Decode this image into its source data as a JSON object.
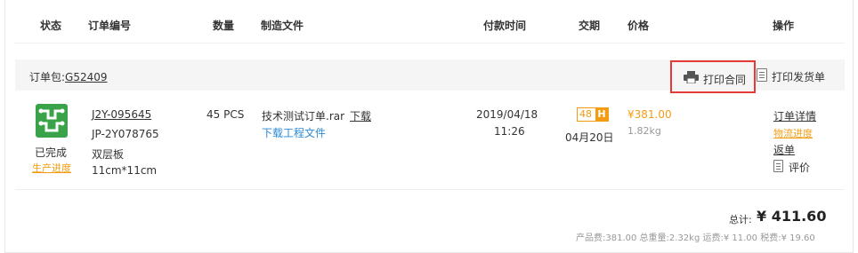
{
  "headers": {
    "status": "状态",
    "order_no": "订单编号",
    "quantity": "数量",
    "files": "制造文件",
    "pay_time": "付款时间",
    "delivery": "交期",
    "price": "价格",
    "actions": "操作"
  },
  "package": {
    "label": "订单包:",
    "code": "G52409",
    "print_contract": "打印合同",
    "print_shipping": "打印发货单"
  },
  "order": {
    "status_text": "已完成",
    "progress_link": "生产进度",
    "order_no": "J2Y-095645",
    "prod_no": "JP-2Y078765",
    "board_type": "双层板",
    "size": "11cm*11cm",
    "quantity": "45 PCS",
    "file_name": "技术测试订单.rar",
    "download": "下载",
    "download_eng": "下载工程文件",
    "pay_date": "2019/04/18",
    "pay_time": "11:26",
    "badge_num": "48",
    "badge_unit": "H",
    "delivery_date": "04月20日",
    "price": "¥381.00",
    "weight": "1.82kg",
    "actions": {
      "detail": "订单详情",
      "logistics": "物流进度",
      "return": "返单",
      "evaluate": "评价"
    }
  },
  "summary": {
    "total_label": "总计:",
    "total_value": "¥ 411.60",
    "breakdown": "产品费:381.00 总重量:2.32kg 运费:¥ 11.00 税费:¥ 19.60"
  },
  "colors": {
    "accent_orange": "#f39c12",
    "link_blue": "#2b8ad9",
    "status_green": "#3aa34a",
    "highlight_red": "#e53935"
  },
  "icons": {
    "status": "circuit-board-icon",
    "print": "printer-icon",
    "ship": "document-icon",
    "evaluate": "document-icon"
  }
}
